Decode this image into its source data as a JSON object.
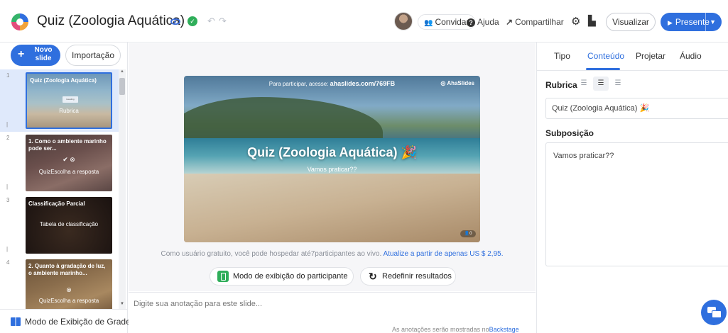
{
  "header": {
    "title": "Quiz (Zoologia Aquática)",
    "invite_label": "Convidar",
    "help_label": "Ajuda",
    "share_label": "Compartilhar",
    "preview_label": "Visualizar",
    "present_label": "Presente"
  },
  "sidebar": {
    "new_slide_label": "Novo slide",
    "import_label": "Importação",
    "grid_view_label": "Modo de Exibição de Grade",
    "slides": [
      {
        "num": "1",
        "title": "Quiz (Zoologia Aquática)",
        "subtitle": "Rubrica",
        "inner": "Heading"
      },
      {
        "num": "2",
        "title": "1. Como o ambiente marinho pode ser...",
        "subtitle": "QuizEscolha a resposta"
      },
      {
        "num": "3",
        "title": "Classificação Parcial",
        "subtitle": "Tabela de classificação"
      },
      {
        "num": "4",
        "title": "2. Quanto à gradação de luz, o ambiente marinho...",
        "subtitle": "QuizEscolha a resposta"
      }
    ]
  },
  "slide": {
    "join_prefix": "Para participar, acesse:",
    "join_url": "ahaslides.com/769FB",
    "brand": "AhaSlides",
    "title": "Quiz (Zoologia Aquática) 🎉",
    "subtitle": "Vamos praticar??",
    "badge": "0"
  },
  "center": {
    "free_note": "Como usuário gratuito, você pode hospedar até7participantes ao vivo.",
    "upgrade_link": "Atualize a partir de apenas US $ 2,95.",
    "participant_view_label": "Modo de exibição do participante",
    "reset_label": "Redefinir resultados",
    "notes_placeholder": "Digite sua anotação para este slide...",
    "notes_hint": "As anotações serão mostradas no",
    "notes_hint_link": "Backstage"
  },
  "right_panel": {
    "tabs": [
      "Tipo",
      "Conteúdo",
      "Projetar",
      "Áudio"
    ],
    "active_tab": "Conteúdo",
    "heading_label": "Rubrica",
    "heading_value": "Quiz (Zoologia Aquática) 🎉",
    "subheading_label": "Subposição",
    "subheading_value": "Vamos praticar??"
  },
  "colors": {
    "accent": "#2f6fde",
    "success": "#2fae5a"
  },
  "icons": [
    "logo-icon",
    "eye-icon",
    "check-circle-icon",
    "undo-icon",
    "redo-icon",
    "invite-icon",
    "help-icon",
    "share-icon",
    "gear-icon",
    "document-icon",
    "play-icon",
    "chevron-down-icon",
    "plus-icon",
    "grid-icon",
    "mobile-icon",
    "refresh-icon",
    "align-left-icon",
    "align-center-icon",
    "align-right-icon",
    "chat-icon"
  ]
}
